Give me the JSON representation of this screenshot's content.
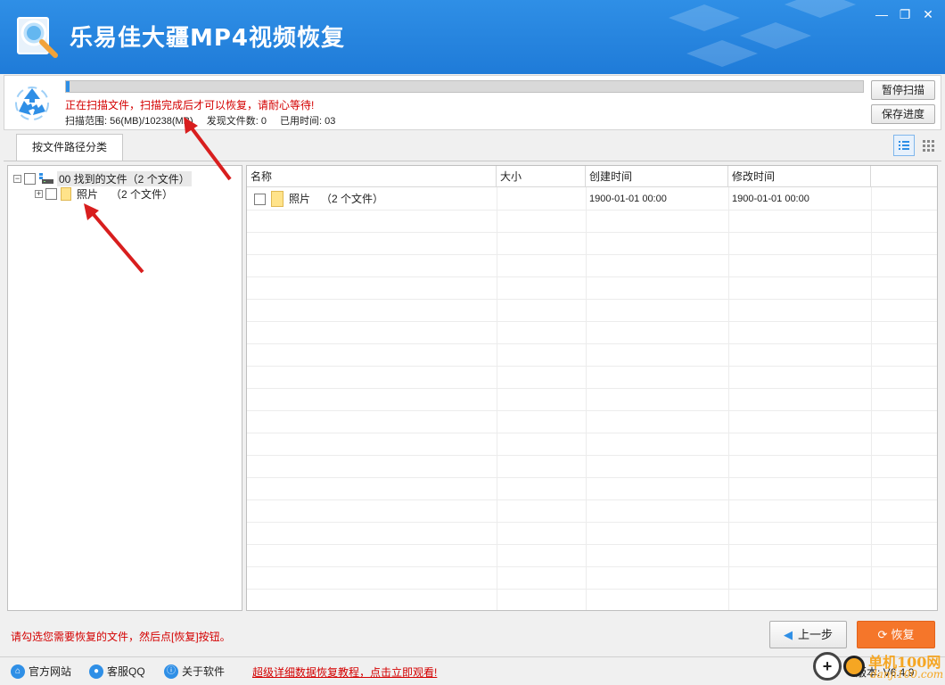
{
  "window": {
    "title": "乐易佳大疆MP4视频恢复",
    "minimize": "—",
    "restore": "❐",
    "close": "✕"
  },
  "scan": {
    "message": "正在扫描文件，扫描完成后才可以恢复，请耐心等待!",
    "range": "扫描范围: 56(MB)/10238(MB)",
    "found": "发现文件数: 0",
    "elapsed": "已用时间: 03",
    "progress": 0.005,
    "pause_label": "暂停扫描",
    "save_label": "保存进度"
  },
  "tabs": [
    {
      "label": "按文件路径分类"
    }
  ],
  "tree": {
    "root": {
      "label": "00 找到的文件（2 个文件）",
      "expander": "−"
    },
    "child": {
      "label": "照片",
      "count": "（2 个文件）",
      "expander": "+"
    }
  },
  "list": {
    "columns": [
      "名称",
      "大小",
      "创建时间",
      "修改时间"
    ],
    "rows": [
      {
        "name": "照片",
        "count": "（2 个文件）",
        "size": "",
        "created": "1900-01-01  00:00",
        "modified": "1900-01-01  00:00"
      }
    ]
  },
  "footer": {
    "hint": "请勾选您需要恢复的文件，然后点[恢复]按钮。",
    "prev_label": "上一步",
    "prev_arrow": "◀",
    "recover_label": "恢复",
    "recover_icon": "⟳"
  },
  "bottombar": {
    "website": "官方网站",
    "qq": "客服QQ",
    "about": "关于软件",
    "tutorial": "超级详细数据恢复教程，点击立即观看!",
    "version": "版本: V6.4.9"
  },
  "watermark": {
    "title": "单机100网",
    "sub": "danji100.com",
    "plus": "+"
  },
  "colors": {
    "accent": "#2f8fe6",
    "warning": "#d40000",
    "recover": "#f5762a"
  }
}
